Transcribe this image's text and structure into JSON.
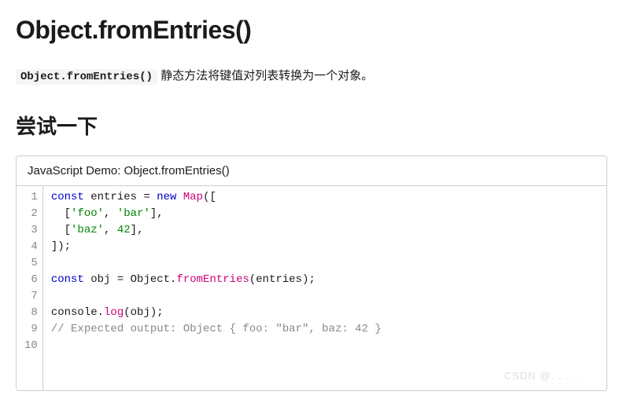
{
  "title": "Object.fromEntries()",
  "intro": {
    "code": "Object.fromEntries()",
    "text": " 静态方法将键值对列表转换为一个对象。"
  },
  "tryit_heading": "尝试一下",
  "demo": {
    "header": "JavaScript Demo: Object.fromEntries()",
    "lines": [
      [
        {
          "t": "const ",
          "c": "kw"
        },
        {
          "t": "entries = "
        },
        {
          "t": "new ",
          "c": "kw"
        },
        {
          "t": "Map",
          "c": "fn"
        },
        {
          "t": "(["
        }
      ],
      [
        {
          "t": "  ["
        },
        {
          "t": "'foo'",
          "c": "str"
        },
        {
          "t": ", "
        },
        {
          "t": "'bar'",
          "c": "str"
        },
        {
          "t": "],"
        }
      ],
      [
        {
          "t": "  ["
        },
        {
          "t": "'baz'",
          "c": "str"
        },
        {
          "t": ", "
        },
        {
          "t": "42",
          "c": "num"
        },
        {
          "t": "],"
        }
      ],
      [
        {
          "t": "]);"
        }
      ],
      [
        {
          "t": ""
        }
      ],
      [
        {
          "t": "const ",
          "c": "kw"
        },
        {
          "t": "obj = Object."
        },
        {
          "t": "fromEntries",
          "c": "fn"
        },
        {
          "t": "(entries);"
        }
      ],
      [
        {
          "t": ""
        }
      ],
      [
        {
          "t": "console."
        },
        {
          "t": "log",
          "c": "fn"
        },
        {
          "t": "(obj);"
        }
      ],
      [
        {
          "t": "// Expected output: Object { foo: \"bar\", baz: 42 }",
          "c": "com"
        }
      ],
      [
        {
          "t": ""
        }
      ]
    ]
  },
  "watermark": "CSDN @.   . . .  ."
}
